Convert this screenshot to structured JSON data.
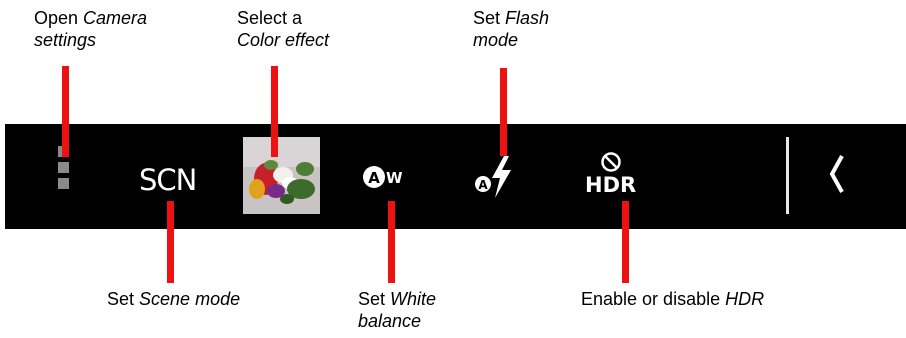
{
  "callouts": {
    "camera_settings": {
      "prefix": "Open ",
      "emph": "Camera",
      "line2": "settings"
    },
    "color_effect": {
      "line1": "Select a",
      "emph": "Color effect"
    },
    "flash_mode": {
      "prefix": "Set ",
      "emph": "Flash",
      "line2": "mode"
    },
    "scene_mode": {
      "prefix": "Set ",
      "emph": "Scene mode"
    },
    "white_balance": {
      "prefix": "Set ",
      "emph": "White",
      "line2": "balance"
    },
    "hdr": {
      "prefix": "Enable or disable ",
      "emph": "HDR"
    }
  },
  "toolbar": {
    "scene_label": "SCN",
    "white_balance_badge": "A",
    "white_balance_suffix": "W",
    "flash_badge": "A",
    "hdr_label": "HDR",
    "icons": {
      "settings": "more-vertical-icon",
      "color_effect": "color-effect-thumbnail",
      "white_balance": "auto-white-balance-icon",
      "flash": "auto-flash-icon",
      "hdr": "hdr-off-icon",
      "expand": "chevron-left-icon"
    }
  },
  "colors": {
    "toolbar_bg": "#000000",
    "pointer": "#ee1111",
    "label_text": "#000000",
    "icon": "#ffffff"
  }
}
